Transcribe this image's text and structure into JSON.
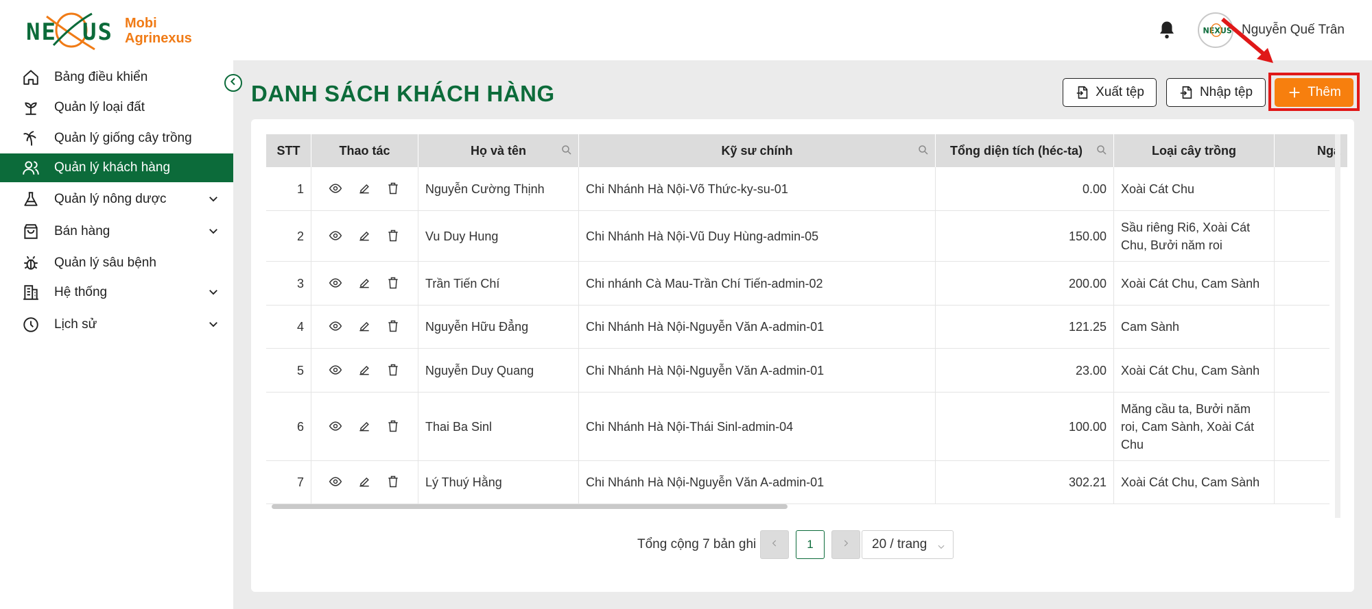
{
  "brand": {
    "logo_text": "NEXUS",
    "app_line1": "Mobi",
    "app_line2": "Agrinexus"
  },
  "header": {
    "user_name": "Nguyễn Quế Trân"
  },
  "sidebar": {
    "items": [
      {
        "label": "Bảng điều khiển",
        "icon": "home-icon"
      },
      {
        "label": "Quản lý loại đất",
        "icon": "sprout-icon"
      },
      {
        "label": "Quản lý giống cây trồng",
        "icon": "palm-tree-icon"
      },
      {
        "label": "Quản lý khách hàng",
        "icon": "users-icon",
        "active": true
      },
      {
        "label": "Quản lý nông dược",
        "icon": "flask-icon",
        "has_children": true
      },
      {
        "label": "Bán hàng",
        "icon": "shopping-bag-icon",
        "has_children": true
      },
      {
        "label": "Quản lý sâu bệnh",
        "icon": "bug-icon"
      },
      {
        "label": "Hệ thống",
        "icon": "building-icon",
        "has_children": true
      },
      {
        "label": "Lịch sử",
        "icon": "clock-icon",
        "has_children": true
      }
    ]
  },
  "page": {
    "title": "DANH SÁCH KHÁCH HÀNG",
    "export_label": "Xuất tệp",
    "import_label": "Nhập tệp",
    "add_label": "Thêm"
  },
  "table": {
    "columns": [
      "STT",
      "Thao tác",
      "Họ và tên",
      "Kỹ sư chính",
      "Tổng diện tích (héc-ta)",
      "Loại cây trồng",
      "Ngà"
    ],
    "rows": [
      {
        "stt": "1",
        "name": "Nguyễn Cường Thịnh",
        "engineer": "Chi Nhánh Hà Nội-Võ Thức-ky-su-01",
        "area": "0.00",
        "crops": "Xoài Cát Chu"
      },
      {
        "stt": "2",
        "name": "Vu Duy Hung",
        "engineer": "Chi Nhánh Hà Nội-Vũ Duy Hùng-admin-05",
        "area": "150.00",
        "crops": "Sầu riêng Ri6, Xoài Cát Chu, Bưởi năm roi"
      },
      {
        "stt": "3",
        "name": "Trần Tiến Chí",
        "engineer": "Chi nhánh Cà Mau-Trần Chí Tiến-admin-02",
        "area": "200.00",
        "crops": "Xoài Cát Chu, Cam Sành"
      },
      {
        "stt": "4",
        "name": "Nguyễn Hữu Đẳng",
        "engineer": "Chi Nhánh Hà Nội-Nguyễn Văn A-admin-01",
        "area": "121.25",
        "crops": "Cam Sành"
      },
      {
        "stt": "5",
        "name": "Nguyễn Duy Quang",
        "engineer": "Chi Nhánh Hà Nội-Nguyễn Văn A-admin-01",
        "area": "23.00",
        "crops": "Xoài Cát Chu, Cam Sành"
      },
      {
        "stt": "6",
        "name": "Thai Ba Sinl",
        "engineer": "Chi Nhánh Hà Nội-Thái Sinl-admin-04",
        "area": "100.00",
        "crops": "Măng cầu ta, Bưởi năm roi, Cam Sành, Xoài Cát Chu"
      },
      {
        "stt": "7",
        "name": "Lý Thuý Hằng",
        "engineer": "Chi Nhánh Hà Nội-Nguyễn Văn A-admin-01",
        "area": "302.21",
        "crops": "Xoài Cát Chu, Cam Sành"
      }
    ]
  },
  "pagination": {
    "total_text": "Tổng cộng 7 bản ghi",
    "current_page": "1",
    "page_size": "20 / trang"
  },
  "colors": {
    "primary_green": "#0c6b3a",
    "accent_orange": "#f77f0e",
    "highlight_red": "#e01818"
  }
}
